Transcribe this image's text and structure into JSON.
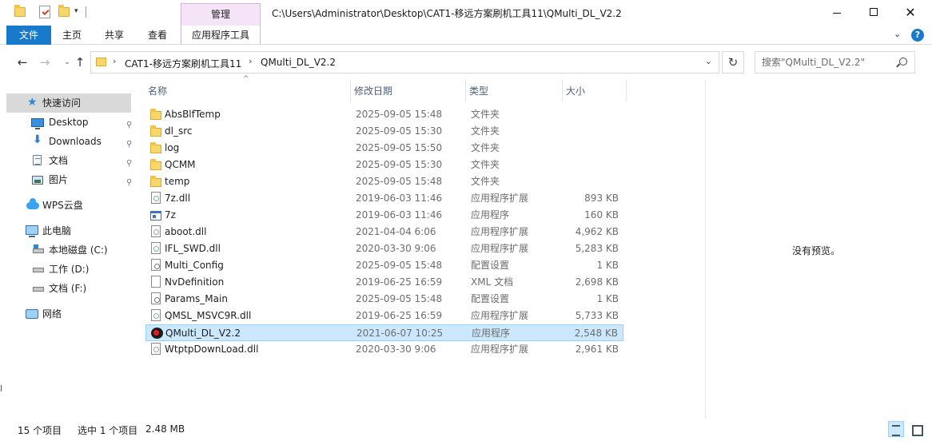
{
  "window": {
    "title": "C:\\Users\\Administrator\\Desktop\\CAT1-移远方案刷机工具11\\QMulti_DL_V2.2",
    "context_tab_header": "管理",
    "min_icon": "minimize-icon",
    "max_icon": "maximize-icon",
    "close_glyph": "✕"
  },
  "quick_access": {
    "dropdown_glyph": "▾"
  },
  "ribbon": {
    "tabs": [
      "文件",
      "主页",
      "共享",
      "查看",
      "应用程序工具"
    ],
    "collapse_glyph": "⌄",
    "help_glyph": "?",
    "accent_color": "#1979ca"
  },
  "nav": {
    "back_glyph": "←",
    "forward_glyph": "→",
    "recent_glyph": "⌄",
    "up_glyph": "↑"
  },
  "address": {
    "separator": "›",
    "crumbs": [
      "CAT1-移远方案刷机工具11",
      "QMulti_DL_V2.2"
    ],
    "dropdown_glyph": "⌄",
    "refresh_glyph": "↻"
  },
  "search": {
    "placeholder": "搜索\"QMulti_DL_V2.2\""
  },
  "sidebar": {
    "items": [
      {
        "label": "快速访问",
        "icon": "star-icon"
      },
      {
        "label": "Desktop",
        "icon": "desktop-icon",
        "pinned": true
      },
      {
        "label": "Downloads",
        "icon": "download-icon",
        "pinned": true
      },
      {
        "label": "文档",
        "icon": "document-icon",
        "pinned": true
      },
      {
        "label": "图片",
        "icon": "picture-icon",
        "pinned": true
      },
      {
        "label": "WPS云盘",
        "icon": "cloud-icon"
      },
      {
        "label": "此电脑",
        "icon": "computer-icon"
      },
      {
        "label": "本地磁盘 (C:)",
        "icon": "drive-icon"
      },
      {
        "label": "工作 (D:)",
        "icon": "drive-icon"
      },
      {
        "label": "文档 (F:)",
        "icon": "drive-icon"
      },
      {
        "label": "网络",
        "icon": "network-icon"
      }
    ],
    "pin_glyph": "📌"
  },
  "columns": {
    "name": "名称",
    "date": "修改日期",
    "type": "类型",
    "size": "大小",
    "sort_glyph": "^"
  },
  "files": [
    {
      "name": "AbsBlfTemp",
      "date": "2025-09-05 15:48",
      "type": "文件夹",
      "size": "",
      "icon": "folder-icon"
    },
    {
      "name": "dl_src",
      "date": "2025-09-05 15:30",
      "type": "文件夹",
      "size": "",
      "icon": "folder-icon"
    },
    {
      "name": "log",
      "date": "2025-09-05 15:50",
      "type": "文件夹",
      "size": "",
      "icon": "folder-icon"
    },
    {
      "name": "QCMM",
      "date": "2025-09-05 15:30",
      "type": "文件夹",
      "size": "",
      "icon": "folder-icon"
    },
    {
      "name": "temp",
      "date": "2025-09-05 15:48",
      "type": "文件夹",
      "size": "",
      "icon": "folder-icon"
    },
    {
      "name": "7z.dll",
      "date": "2019-06-03 11:46",
      "type": "应用程序扩展",
      "size": "893 KB",
      "icon": "dll-icon"
    },
    {
      "name": "7z",
      "date": "2019-06-03 11:46",
      "type": "应用程序",
      "size": "160 KB",
      "icon": "exe-icon"
    },
    {
      "name": "aboot.dll",
      "date": "2021-04-04 6:06",
      "type": "应用程序扩展",
      "size": "4,962 KB",
      "icon": "dll-icon"
    },
    {
      "name": "IFL_SWD.dll",
      "date": "2020-03-30 9:06",
      "type": "应用程序扩展",
      "size": "5,283 KB",
      "icon": "dll-icon"
    },
    {
      "name": "Multi_Config",
      "date": "2025-09-05 15:48",
      "type": "配置设置",
      "size": "1 KB",
      "icon": "config-file-icon"
    },
    {
      "name": "NvDefinition",
      "date": "2019-06-25 16:59",
      "type": "XML 文档",
      "size": "2,698 KB",
      "icon": "file-icon"
    },
    {
      "name": "Params_Main",
      "date": "2025-09-05 15:48",
      "type": "配置设置",
      "size": "1 KB",
      "icon": "config-file-icon"
    },
    {
      "name": "QMSL_MSVC9R.dll",
      "date": "2019-06-25 16:59",
      "type": "应用程序扩展",
      "size": "5,733 KB",
      "icon": "dll-icon"
    },
    {
      "name": "QMulti_DL_V2.2",
      "date": "2021-06-07 10:25",
      "type": "应用程序",
      "size": "2,548 KB",
      "icon": "app-icon",
      "selected": true
    },
    {
      "name": "WtptpDownLoad.dll",
      "date": "2020-03-30 9:06",
      "type": "应用程序扩展",
      "size": "2,961 KB",
      "icon": "dll-icon"
    }
  ],
  "preview": {
    "text": "没有预览。"
  },
  "status": {
    "count": "15 个项目",
    "selected": "选中 1 个项目",
    "size": "2.48 MB"
  },
  "left_edge": {
    "glyph": "l"
  }
}
